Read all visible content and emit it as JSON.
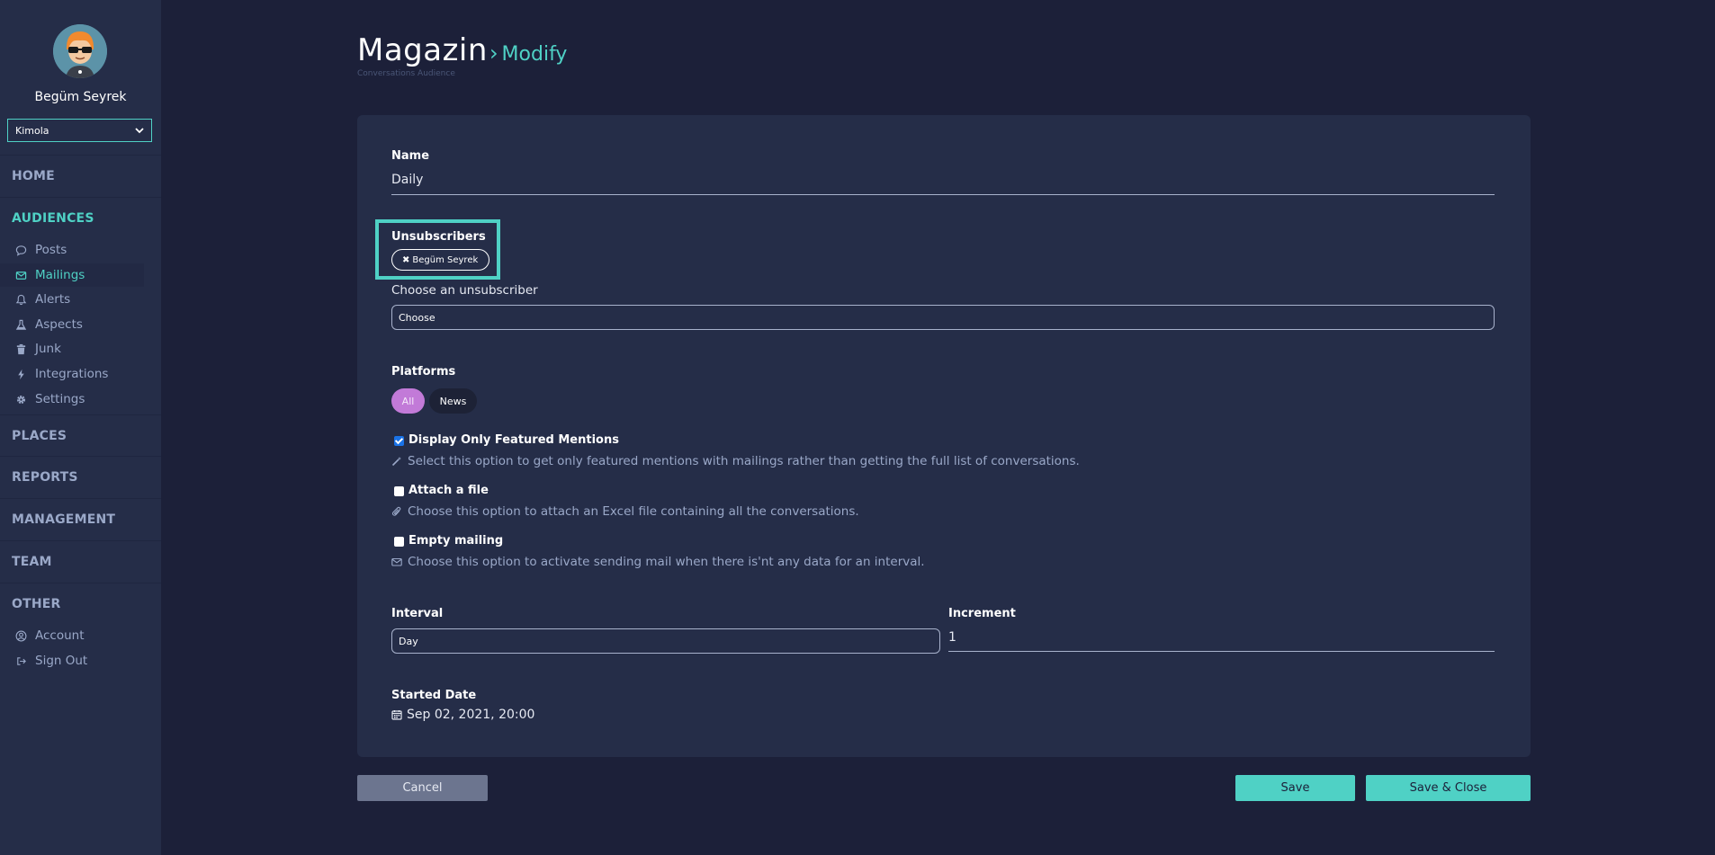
{
  "sidebar": {
    "user_name": "Begüm Seyrek",
    "org_select": "Kimola",
    "sections": {
      "home": "HOME",
      "audiences": "AUDIENCES",
      "places": "PLACES",
      "reports": "REPORTS",
      "management": "MANAGEMENT",
      "team": "TEAM",
      "other": "OTHER"
    },
    "audience_items": [
      {
        "label": "Posts",
        "icon": "comment-icon"
      },
      {
        "label": "Mailings",
        "icon": "envelope-icon"
      },
      {
        "label": "Alerts",
        "icon": "bell-icon"
      },
      {
        "label": "Aspects",
        "icon": "flask-icon"
      },
      {
        "label": "Junk",
        "icon": "trash-icon"
      },
      {
        "label": "Integrations",
        "icon": "bolt-icon"
      },
      {
        "label": "Settings",
        "icon": "gear-icon"
      }
    ],
    "other_items": [
      {
        "label": "Account",
        "icon": "user-circle-icon"
      },
      {
        "label": "Sign Out",
        "icon": "sign-out-icon"
      }
    ]
  },
  "header": {
    "title": "Magazin",
    "arrow": "›",
    "subtitle": "Modify",
    "breadcrumb": "Conversations Audience"
  },
  "form": {
    "name_label": "Name",
    "name_value": "Daily",
    "unsubscribers_label": "Unsubscribers",
    "unsubscriber_chip": "Begüm Seyrek",
    "choose_label": "Choose an unsubscriber",
    "choose_value": "Choose",
    "platforms_label": "Platforms",
    "platforms": [
      "All",
      "News"
    ],
    "options": [
      {
        "title": "Display Only Featured Mentions",
        "checked": true,
        "desc": "Select this option to get only featured mentions with mailings rather than getting the full list of conversations.",
        "icon": "magic-wand-icon"
      },
      {
        "title": "Attach a file",
        "checked": false,
        "desc": "Choose this option to attach an Excel file containing all the conversations.",
        "icon": "paperclip-icon"
      },
      {
        "title": "Empty mailing",
        "checked": false,
        "desc": "Choose this option to activate sending mail when there is'nt any data for an interval.",
        "icon": "envelope-icon"
      }
    ],
    "interval_label": "Interval",
    "interval_value": "Day",
    "increment_label": "Increment",
    "increment_value": "1",
    "started_label": "Started Date",
    "started_value": "Sep 02, 2021, 20:00"
  },
  "actions": {
    "cancel": "Cancel",
    "save": "Save",
    "save_close": "Save & Close"
  },
  "colors": {
    "accent": "#4fd1c5",
    "pill_active": "#c27ad8",
    "background": "#1c2039",
    "panel": "#252d48"
  }
}
